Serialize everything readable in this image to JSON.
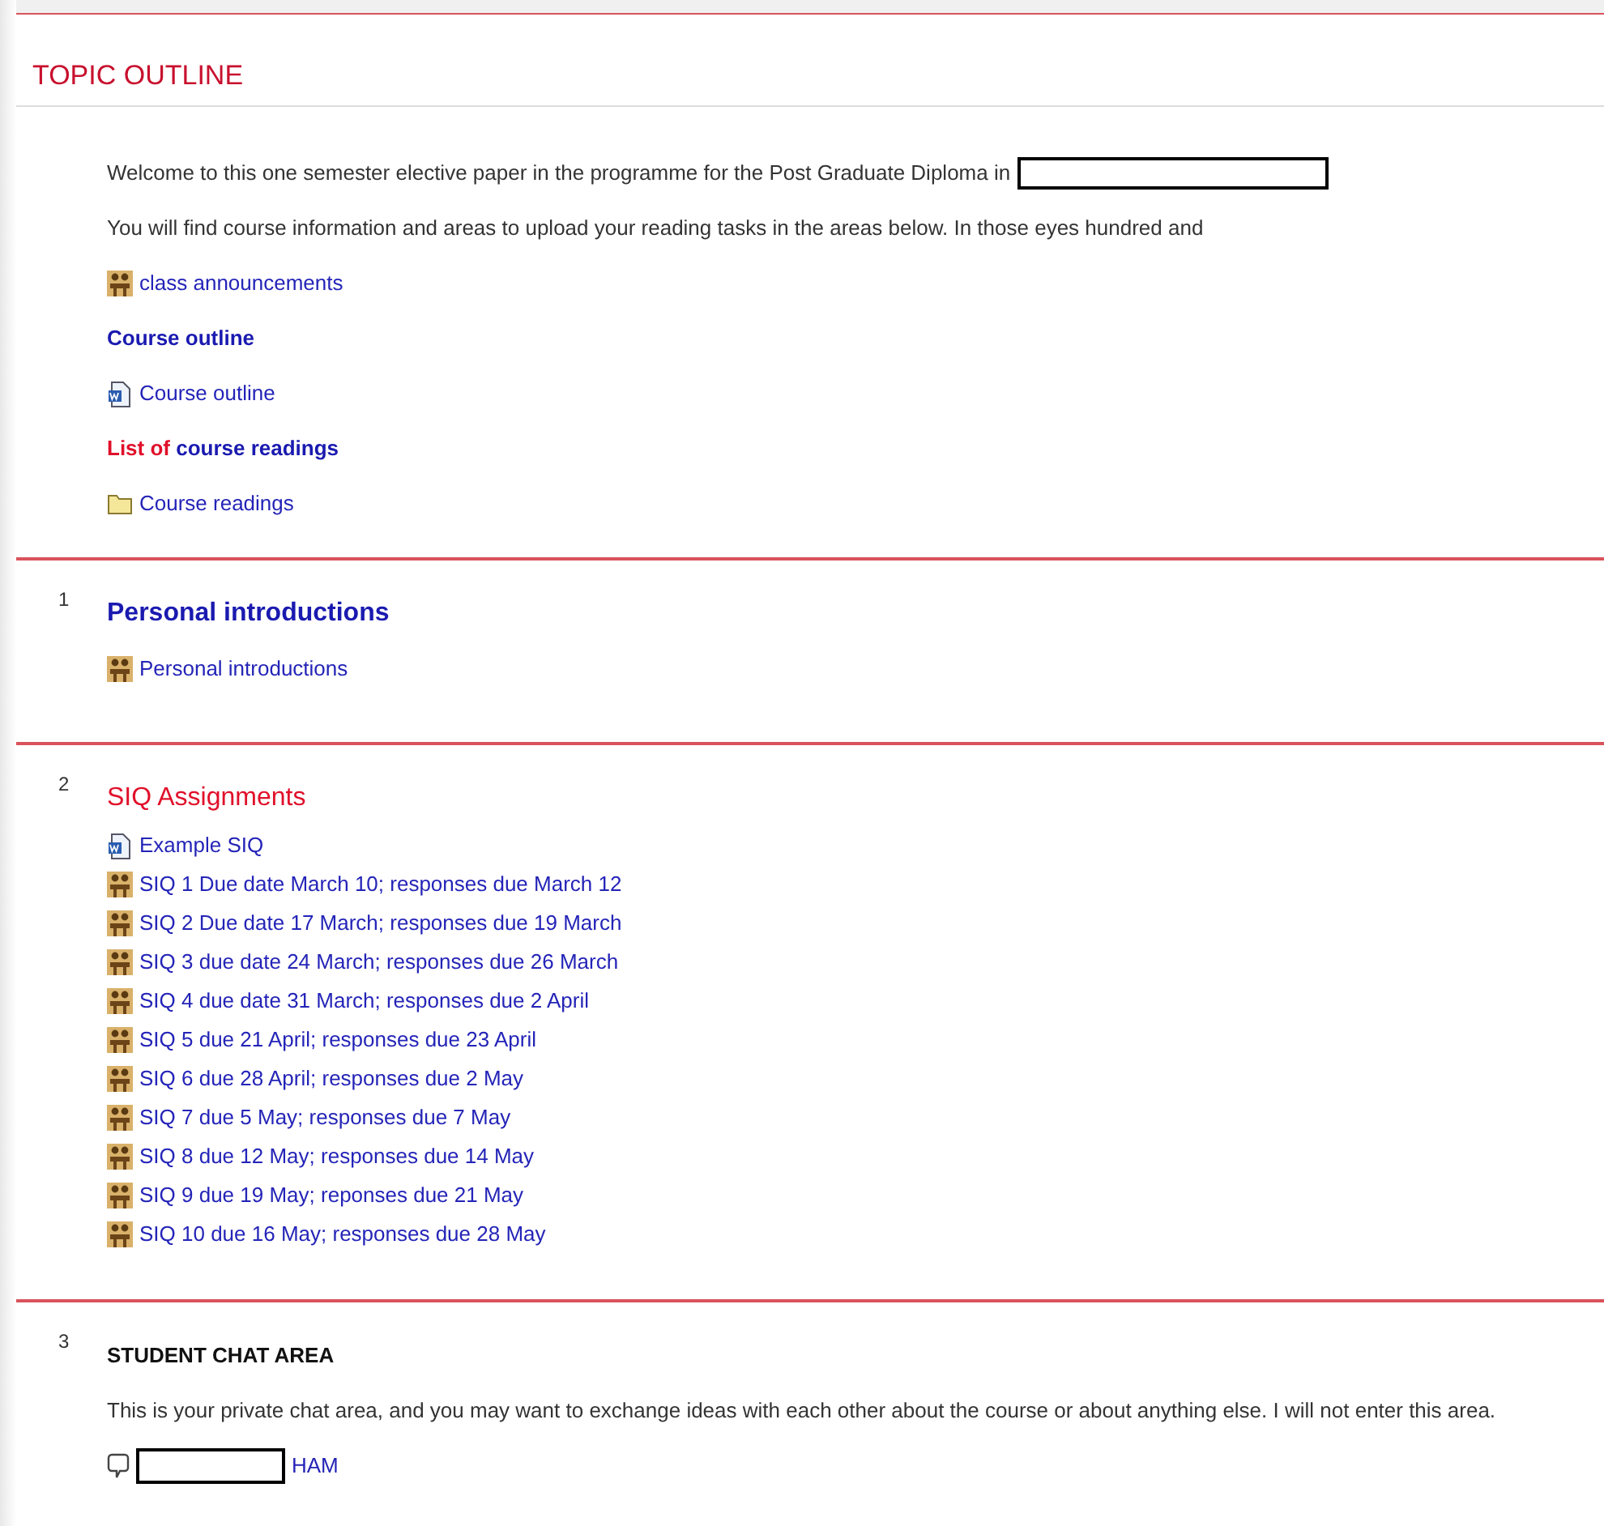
{
  "title": "TOPIC OUTLINE",
  "sections": [
    {
      "rows": [
        {
          "kind": "text",
          "text": "Welcome to this one semester elective paper in the programme for the Post Graduate Diploma in",
          "redacted": true
        },
        {
          "kind": "text",
          "text": "You will find course information and areas to upload your reading tasks in the areas below. In those eyes hundred and"
        },
        {
          "kind": "forum",
          "text": "class announcements"
        },
        {
          "kind": "label",
          "parts": [
            {
              "text": "Course outline",
              "color": "#1a1ab0"
            }
          ]
        },
        {
          "kind": "doc",
          "text": "Course outline"
        },
        {
          "kind": "label",
          "parts": [
            {
              "text": "List of ",
              "color": "#e0102a"
            },
            {
              "text": "course readings",
              "color": "#1a1ab0"
            }
          ]
        },
        {
          "kind": "folder",
          "text": "Course readings"
        }
      ]
    },
    {
      "number": "1",
      "heading": {
        "kind": "blue",
        "text": "Personal introductions"
      },
      "rows": [
        {
          "kind": "forum",
          "text": "Personal introductions"
        }
      ]
    },
    {
      "number": "2",
      "heading": {
        "kind": "red",
        "text": "SIQ Assignments"
      },
      "rows": [
        {
          "kind": "doc",
          "text": "Example SIQ"
        },
        {
          "kind": "forum",
          "text": "SIQ 1 Due date March 10; responses due March 12"
        },
        {
          "kind": "forum",
          "text": "SIQ 2 Due date 17 March; responses due 19 March"
        },
        {
          "kind": "forum",
          "text": "SIQ 3 due date 24 March; responses due 26 March"
        },
        {
          "kind": "forum",
          "text": "SIQ 4 due date 31 March; responses due 2 April"
        },
        {
          "kind": "forum",
          "text": "SIQ 5 due 21 April; responses due 23 April"
        },
        {
          "kind": "forum",
          "text": "SIQ 6 due 28 April; responses due 2 May"
        },
        {
          "kind": "forum",
          "text": "SIQ 7 due 5 May; responses due 7 May"
        },
        {
          "kind": "forum",
          "text": "SIQ 8 due 12 May; responses due 14 May"
        },
        {
          "kind": "forum",
          "text": "SIQ 9 due 19 May; reponses due 21 May"
        },
        {
          "kind": "forum",
          "text": "SIQ 10 due 16 May; responses due 28 May"
        }
      ]
    },
    {
      "number": "3",
      "heading": {
        "kind": "black",
        "text": "STUDENT CHAT AREA"
      },
      "rows": [
        {
          "kind": "text",
          "text": "This is your private chat area, and you may want to exchange ideas with each other about the course or about anything else. I will not enter this area."
        },
        {
          "kind": "chat",
          "text": "HAM",
          "redacted": true
        }
      ]
    }
  ]
}
